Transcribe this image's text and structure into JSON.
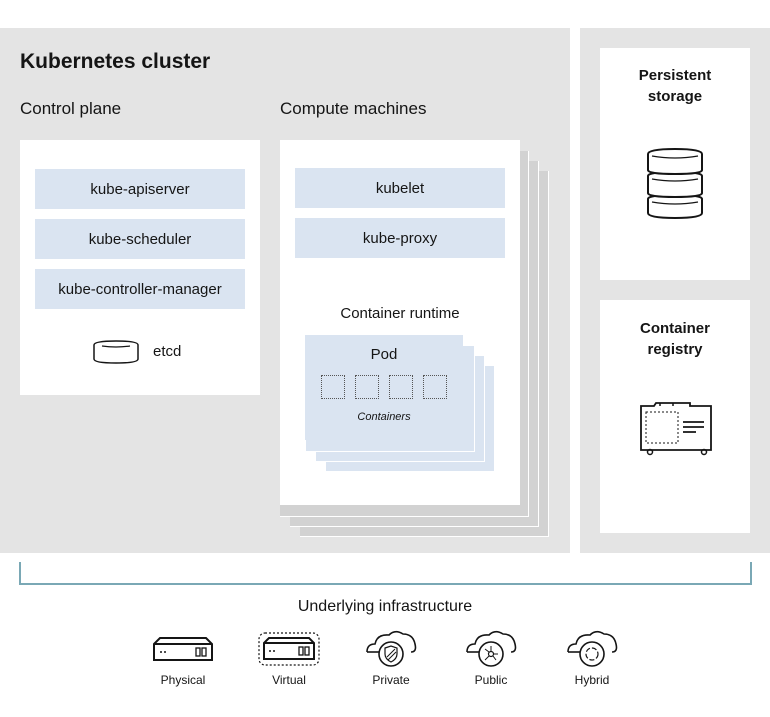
{
  "cluster": {
    "title": "Kubernetes cluster",
    "control_plane": {
      "title": "Control plane",
      "components": [
        "kube-apiserver",
        "kube-scheduler",
        "kube-controller-manager"
      ],
      "etcd_label": "etcd",
      "etcd_icon": "database-disk-icon"
    },
    "compute": {
      "title": "Compute machines",
      "components": [
        "kubelet",
        "kube-proxy"
      ],
      "runtime_label": "Container runtime",
      "pod_label": "Pod",
      "containers_label": "Containers"
    }
  },
  "side": {
    "storage": {
      "title_line1": "Persistent",
      "title_line2": "storage",
      "icon": "database-stack-icon"
    },
    "registry": {
      "title_line1": "Container",
      "title_line2": "registry",
      "icon": "registry-cabinet-icon"
    }
  },
  "infrastructure": {
    "title": "Underlying infrastructure",
    "items": [
      {
        "label": "Physical",
        "icon": "server-icon"
      },
      {
        "label": "Virtual",
        "icon": "virtual-server-icon"
      },
      {
        "label": "Private",
        "icon": "cloud-shield-icon"
      },
      {
        "label": "Public",
        "icon": "cloud-network-icon"
      },
      {
        "label": "Hybrid",
        "icon": "cloud-cycle-icon"
      }
    ]
  },
  "colors": {
    "band": "#e4e4e4",
    "component_fill": "#dae4f1",
    "bracket": "#7aa8b5"
  }
}
